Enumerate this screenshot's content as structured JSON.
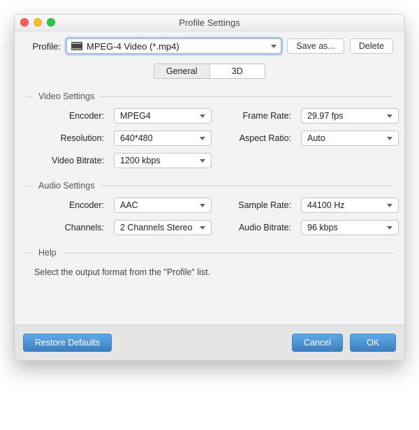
{
  "window": {
    "title": "Profile Settings"
  },
  "profile": {
    "label": "Profile:",
    "value": "MPEG-4 Video (*.mp4)",
    "save_as_label": "Save as...",
    "delete_label": "Delete"
  },
  "tabs": {
    "general": "General",
    "three_d": "3D",
    "active": "general"
  },
  "video": {
    "legend": "Video Settings",
    "encoder_label": "Encoder:",
    "encoder_value": "MPEG4",
    "resolution_label": "Resolution:",
    "resolution_value": "640*480",
    "bitrate_label": "Video Bitrate:",
    "bitrate_value": "1200 kbps",
    "framerate_label": "Frame Rate:",
    "framerate_value": "29.97 fps",
    "aspect_label": "Aspect Ratio:",
    "aspect_value": "Auto"
  },
  "audio": {
    "legend": "Audio Settings",
    "encoder_label": "Encoder:",
    "encoder_value": "AAC",
    "channels_label": "Channels:",
    "channels_value": "2 Channels Stereo",
    "samplerate_label": "Sample Rate:",
    "samplerate_value": "44100 Hz",
    "bitrate_label": "Audio Bitrate:",
    "bitrate_value": "96 kbps"
  },
  "help": {
    "legend": "Help",
    "text": "Select the output format from the \"Profile\" list."
  },
  "footer": {
    "restore_label": "Restore Defaults",
    "cancel_label": "Cancel",
    "ok_label": "OK"
  }
}
